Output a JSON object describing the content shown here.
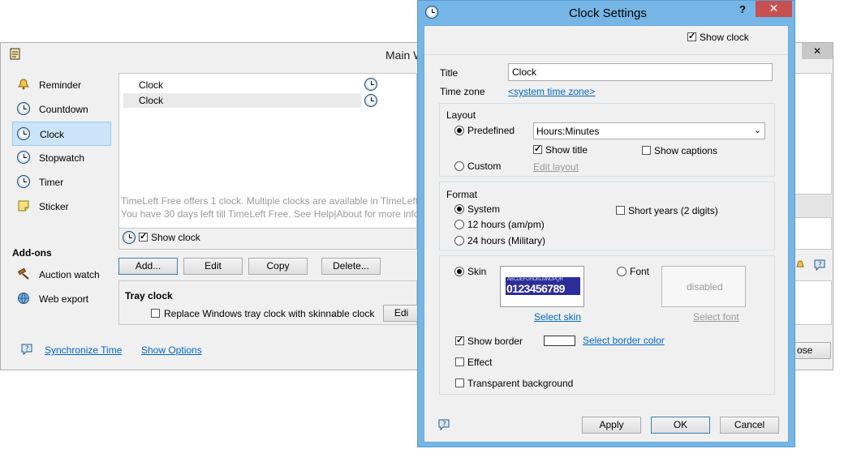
{
  "main_window": {
    "title": "Main Window",
    "nav_items": [
      {
        "label": "Reminder",
        "icon": "bell-icon"
      },
      {
        "label": "Countdown",
        "icon": "countdown-icon"
      },
      {
        "label": "Clock",
        "icon": "clock-icon"
      },
      {
        "label": "Stopwatch",
        "icon": "stopwatch-icon"
      },
      {
        "label": "Timer",
        "icon": "timer-icon"
      },
      {
        "label": "Sticker",
        "icon": "sticker-icon"
      }
    ],
    "addons_heading": "Add-ons",
    "addon_items": [
      {
        "label": "Auction watch",
        "icon": "gavel-icon"
      },
      {
        "label": "Web export",
        "icon": "globe-icon"
      }
    ],
    "clock_list": [
      "Clock",
      "Clock"
    ],
    "info_line1": "TimeLeft Free offers 1 clock. Multiple clocks are available in TimeLeft",
    "info_line2": "You have 30 days left till TimeLeft Free. See Help|About for more infor",
    "show_clock_label": "Show clock",
    "buttons": {
      "add": "Add...",
      "edit": "Edit",
      "copy": "Copy",
      "delete": "Delete..."
    },
    "tray_clock_title": "Tray clock",
    "tray_replace_label": "Replace Windows tray clock with skinnable clock",
    "tray_edit": "Edi",
    "synchronize_time": "Synchronize Time",
    "show_options": "Show Options",
    "close_partial": "ose"
  },
  "dialog": {
    "title": "Clock Settings",
    "help_glyph": "?",
    "close_glyph": "✕",
    "show_clock_label": "Show clock",
    "title_label": "Title",
    "title_value": "Clock",
    "time_zone_label": "Time zone",
    "time_zone_value": "<system time zone>",
    "layout_heading": "Layout",
    "predefined_label": "Predefined",
    "predefined_value": "Hours:Minutes",
    "show_title_label": "Show title",
    "show_captions_label": "Show captions",
    "custom_label": "Custom",
    "edit_layout": "Edit layout",
    "format_heading": "Format",
    "format_system": "System",
    "format_12h": "12 hours (am/pm)",
    "format_24h": "24 hours (Military)",
    "short_years_label": "Short years (2 digits)",
    "skin_label": "Skin",
    "skin_preview_top": "ABCDEFGHIJKLMNOPQR",
    "skin_preview_digits": "0123456789",
    "select_skin": "Select skin",
    "font_label": "Font",
    "font_preview": "disabled",
    "select_font": "Select font",
    "show_border_label": "Show border",
    "select_border_color": "Select border color",
    "effect_label": "Effect",
    "transparent_bg_label": "Transparent background",
    "apply": "Apply",
    "ok": "OK",
    "cancel": "Cancel"
  },
  "colors": {
    "accent": "#0066cc",
    "dialog_frame": "#75b6e7",
    "selection": "#cce4f7",
    "skin_bg": "#2d2d9a"
  }
}
